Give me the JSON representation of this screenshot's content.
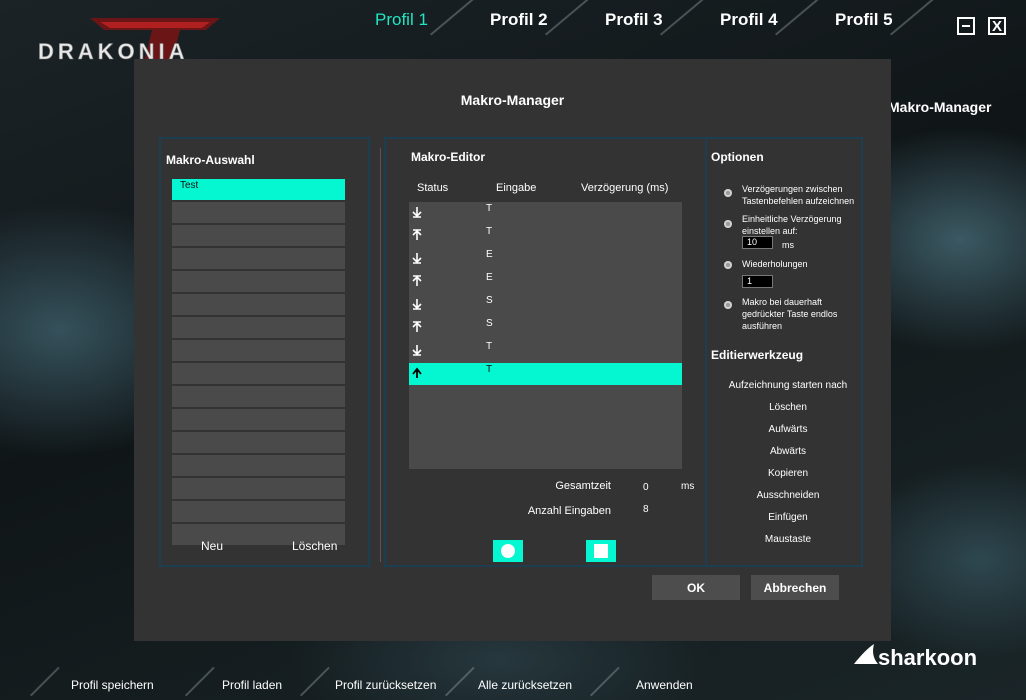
{
  "header": {
    "logo_text": "DRAKONIA",
    "profiles": [
      "Profil 1",
      "Profil 2",
      "Profil 3",
      "Profil 4",
      "Profil 5"
    ],
    "active_profile": "Profil 1",
    "minimize_icon": "minimize-icon",
    "close_label": "X"
  },
  "background_label": "Makro-Manager",
  "dialog": {
    "title": "Makro-Manager",
    "macro_select": {
      "title": "Makro-Auswahl",
      "items": [
        "Test",
        "",
        "",
        "",
        "",
        "",
        "",
        "",
        "",
        "",
        "",
        "",
        "",
        "",
        "",
        ""
      ],
      "selected": "Test",
      "new_label": "Neu",
      "delete_label": "Löschen"
    },
    "editor": {
      "title": "Makro-Editor",
      "columns": [
        "Status",
        "Eingabe",
        "Verzögerung (ms)"
      ],
      "events": [
        {
          "status": "down",
          "icon": "arrow-down-icon",
          "input": "T"
        },
        {
          "status": "up",
          "icon": "arrow-up-icon",
          "input": "T"
        },
        {
          "status": "down",
          "icon": "arrow-down-icon",
          "input": "E"
        },
        {
          "status": "up",
          "icon": "arrow-up-icon",
          "input": "E"
        },
        {
          "status": "down",
          "icon": "arrow-down-icon",
          "input": "S"
        },
        {
          "status": "up",
          "icon": "arrow-up-icon",
          "input": "S"
        },
        {
          "status": "down",
          "icon": "arrow-down-icon",
          "input": "T"
        },
        {
          "status": "up",
          "icon": "arrow-up-icon",
          "input": "T"
        }
      ],
      "selected_event_index": 7,
      "total_time_label": "Gesamtzeit",
      "total_time_value": "0",
      "total_time_unit": "ms",
      "input_count_label": "Anzahl Eingaben",
      "input_count_value": "8",
      "record_icon": "record-icon",
      "stop_icon": "stop-icon"
    },
    "options": {
      "title": "Optionen",
      "record_delays": "Verzögerungen zwischen Tastenbefehlen aufzeichnen",
      "uniform_delay": "Einheitliche Verzögerung einstellen auf:",
      "uniform_delay_value": "10",
      "uniform_delay_unit": "ms",
      "repetitions": "Wiederholungen",
      "repetitions_value": "1",
      "endless": "Makro bei dauerhaft gedrückter Taste endlos ausführen"
    },
    "tools": {
      "title": "Editierwerkzeug",
      "items": [
        "Aufzeichnung starten nach",
        "Löschen",
        "Aufwärts",
        "Abwärts",
        "Kopieren",
        "Ausschneiden",
        "Einfügen",
        "Maustaste"
      ]
    },
    "ok_label": "OK",
    "cancel_label": "Abbrechen"
  },
  "footer": {
    "items": [
      "Profil speichern",
      "Profil laden",
      "Profil zurücksetzen",
      "Alle zurücksetzen",
      "Anwenden"
    ],
    "brand": "sharkoon"
  },
  "colors": {
    "accent": "#04f7d0",
    "active_tab": "#1fe6c4",
    "dialog_bg": "#333333",
    "row_bg": "#4a4a4a",
    "panel_border": "#1d3e50"
  }
}
